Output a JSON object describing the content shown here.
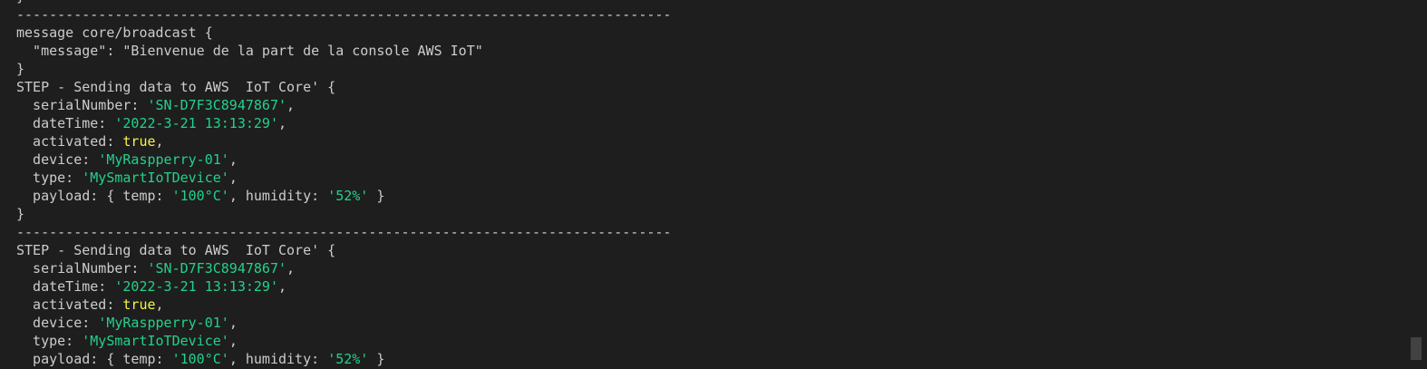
{
  "terminal": {
    "lines": [
      [
        {
          "t": "}",
          "c": "plain"
        }
      ],
      [
        {
          "t": "--------------------------------------------------------------------------------",
          "c": "sep"
        }
      ],
      [
        {
          "t": "message core/broadcast {",
          "c": "plain"
        }
      ],
      [
        {
          "t": "  \"message\": \"Bienvenue de la part de la console AWS IoT\"",
          "c": "plain"
        }
      ],
      [
        {
          "t": "}",
          "c": "plain"
        }
      ],
      [
        {
          "t": "STEP - Sending data to AWS  IoT Core' {",
          "c": "plain"
        }
      ],
      [
        {
          "t": "  serialNumber: ",
          "c": "plain"
        },
        {
          "t": "'SN-D7F3C8947867'",
          "c": "str"
        },
        {
          "t": ",",
          "c": "plain"
        }
      ],
      [
        {
          "t": "  dateTime: ",
          "c": "plain"
        },
        {
          "t": "'2022-3-21 13:13:29'",
          "c": "str"
        },
        {
          "t": ",",
          "c": "plain"
        }
      ],
      [
        {
          "t": "  activated: ",
          "c": "plain"
        },
        {
          "t": "true",
          "c": "kw"
        },
        {
          "t": ",",
          "c": "plain"
        }
      ],
      [
        {
          "t": "  device: ",
          "c": "plain"
        },
        {
          "t": "'MyRaspperry-01'",
          "c": "str"
        },
        {
          "t": ",",
          "c": "plain"
        }
      ],
      [
        {
          "t": "  type: ",
          "c": "plain"
        },
        {
          "t": "'MySmartIoTDevice'",
          "c": "str"
        },
        {
          "t": ",",
          "c": "plain"
        }
      ],
      [
        {
          "t": "  payload: { temp: ",
          "c": "plain"
        },
        {
          "t": "'100°C'",
          "c": "str"
        },
        {
          "t": ", humidity: ",
          "c": "plain"
        },
        {
          "t": "'52%'",
          "c": "str"
        },
        {
          "t": " }",
          "c": "plain"
        }
      ],
      [
        {
          "t": "}",
          "c": "plain"
        }
      ],
      [
        {
          "t": "--------------------------------------------------------------------------------",
          "c": "sep"
        }
      ],
      [
        {
          "t": "STEP - Sending data to AWS  IoT Core' {",
          "c": "plain"
        }
      ],
      [
        {
          "t": "  serialNumber: ",
          "c": "plain"
        },
        {
          "t": "'SN-D7F3C8947867'",
          "c": "str"
        },
        {
          "t": ",",
          "c": "plain"
        }
      ],
      [
        {
          "t": "  dateTime: ",
          "c": "plain"
        },
        {
          "t": "'2022-3-21 13:13:29'",
          "c": "str"
        },
        {
          "t": ",",
          "c": "plain"
        }
      ],
      [
        {
          "t": "  activated: ",
          "c": "plain"
        },
        {
          "t": "true",
          "c": "kw"
        },
        {
          "t": ",",
          "c": "plain"
        }
      ],
      [
        {
          "t": "  device: ",
          "c": "plain"
        },
        {
          "t": "'MyRaspperry-01'",
          "c": "str"
        },
        {
          "t": ",",
          "c": "plain"
        }
      ],
      [
        {
          "t": "  type: ",
          "c": "plain"
        },
        {
          "t": "'MySmartIoTDevice'",
          "c": "str"
        },
        {
          "t": ",",
          "c": "plain"
        }
      ],
      [
        {
          "t": "  payload: { temp: ",
          "c": "plain"
        },
        {
          "t": "'100°C'",
          "c": "str"
        },
        {
          "t": ", humidity: ",
          "c": "plain"
        },
        {
          "t": "'52%'",
          "c": "str"
        },
        {
          "t": " }",
          "c": "plain"
        }
      ]
    ]
  },
  "colors": {
    "background": "#1e1e1e",
    "text": "#cccccc",
    "string": "#23d18b",
    "boolean": "#f5f543",
    "scrollbar_thumb": "#424242"
  }
}
